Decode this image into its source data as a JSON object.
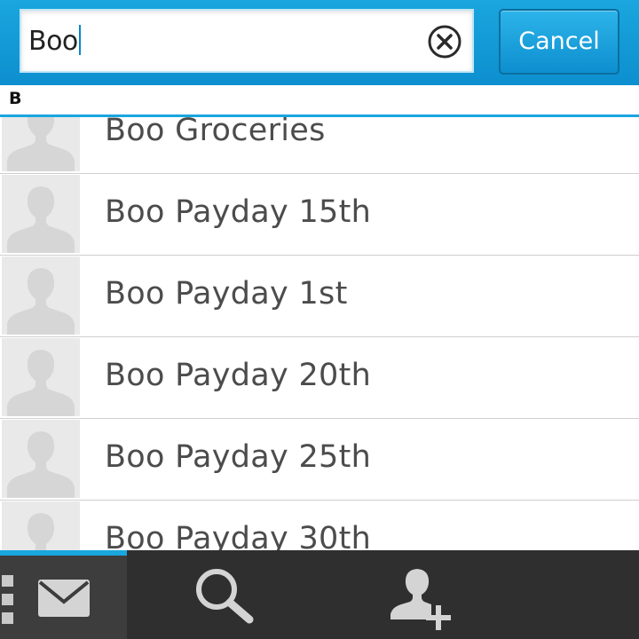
{
  "search": {
    "query": "Boo",
    "cancel_label": "Cancel"
  },
  "list": {
    "section_letter": "B",
    "items": [
      {
        "label": "Boo Groceries"
      },
      {
        "label": "Boo Payday 15th"
      },
      {
        "label": "Boo Payday 1st"
      },
      {
        "label": "Boo Payday 20th"
      },
      {
        "label": "Boo Payday 25th"
      },
      {
        "label": "Boo Payday 30th"
      }
    ]
  },
  "actionbar": {
    "icons": [
      "overflow-menu-icon",
      "envelope-icon",
      "search-icon",
      "add-contact-icon"
    ],
    "active_tab": "messages"
  },
  "colors": {
    "accent": "#1aa6de",
    "header_bg": "#0d8fcf",
    "actionbar_bg": "#2f2f2f",
    "text": "#4c4c4c"
  }
}
